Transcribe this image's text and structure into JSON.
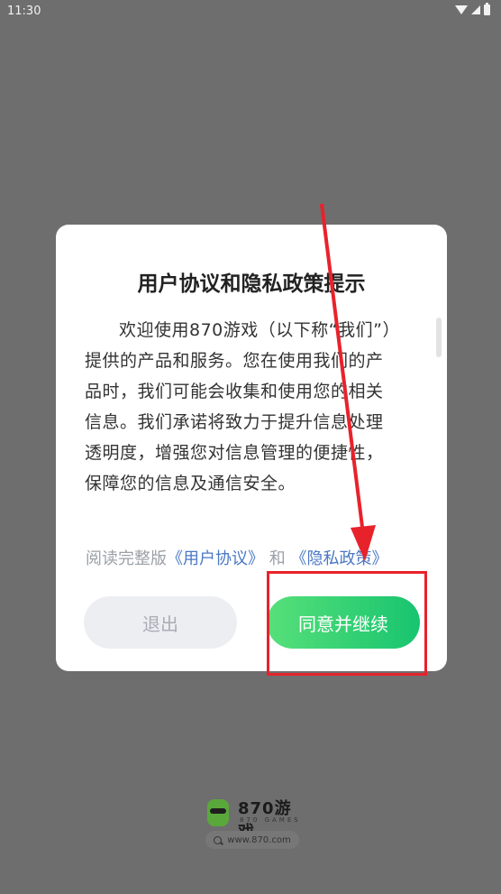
{
  "status_bar": {
    "time": "11:30"
  },
  "dialog": {
    "title": "用户协议和隐私政策提示",
    "body": "欢迎使用870游戏（以下称“我们”）提供的产品和服务。您在使用我们的产品时，我们可能会收集和使用您的相关信息。我们承诺将致力于提升信息处理透明度，增强您对信息管理的便捷性，保障您的信息及通信安全。",
    "links_prefix": "阅读完整版",
    "user_agreement_link": "《用户协议》",
    "links_conjunction": "和",
    "privacy_policy_link": "《隐私政策》",
    "exit_label": "退出",
    "agree_label": "同意并继续"
  },
  "footer": {
    "logo_text": "870游戏",
    "logo_sub": "870 GAMES",
    "url": "www.870.com"
  },
  "colors": {
    "overlay": "#6e6e6e",
    "agree_gradient_start": "#57e07a",
    "agree_gradient_end": "#18c46f",
    "annotation": "#e8222b",
    "link": "#4a78c4"
  }
}
